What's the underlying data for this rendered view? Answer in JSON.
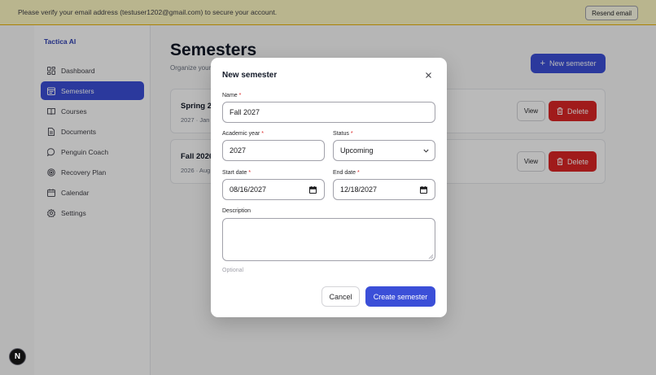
{
  "banner": {
    "text": "Please verify your email address (testuser1202@gmail.com) to secure your account.",
    "resend_label": "Resend email"
  },
  "sidebar": {
    "brand": "Tactica AI",
    "items": [
      {
        "label": "Dashboard",
        "icon": "dashboard-icon",
        "active": false
      },
      {
        "label": "Semesters",
        "icon": "calendar-list-icon",
        "active": true
      },
      {
        "label": "Courses",
        "icon": "book-icon",
        "active": false
      },
      {
        "label": "Documents",
        "icon": "document-icon",
        "active": false
      },
      {
        "label": "Penguin Coach",
        "icon": "chat-bubble-icon",
        "active": false
      },
      {
        "label": "Recovery Plan",
        "icon": "target-icon",
        "active": false
      },
      {
        "label": "Calendar",
        "icon": "calendar-icon",
        "active": false
      },
      {
        "label": "Settings",
        "icon": "gear-icon",
        "active": false
      }
    ]
  },
  "main": {
    "title": "Semesters",
    "subtitle": "Organize your",
    "new_button_label": "New semester",
    "cards": [
      {
        "title": "Spring 20",
        "meta": "2027 · Jan",
        "view_label": "View",
        "delete_label": "Delete"
      },
      {
        "title": "Fall 2026",
        "meta": "2026 · Aug",
        "view_label": "View",
        "delete_label": "Delete"
      }
    ]
  },
  "modal": {
    "title": "New semester",
    "name_label": "Name",
    "name_value": "Fall 2027",
    "academic_year_label": "Academic year",
    "academic_year_value": "2027",
    "status_label": "Status",
    "status_value": "Upcoming",
    "start_date_label": "Start date",
    "start_date_value": "08/16/2027",
    "end_date_label": "End date",
    "end_date_value": "12/18/2027",
    "description_label": "Description",
    "description_hint": "Optional",
    "required_mark": "*",
    "cancel_label": "Cancel",
    "create_label": "Create semester"
  },
  "badge": {
    "letter": "N"
  },
  "colors": {
    "accent": "#3b4fd8",
    "danger": "#dc2626",
    "banner_bg": "#fef9c3",
    "brand": "#2e3fb3"
  }
}
